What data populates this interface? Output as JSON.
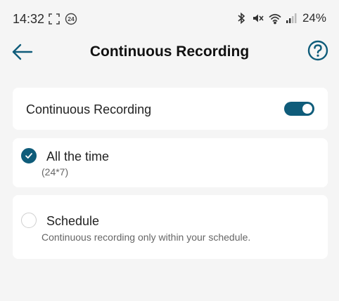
{
  "status_bar": {
    "time": "14:32",
    "battery": "24%",
    "icons": [
      "screenshot-icon",
      "24-badge-icon",
      "bluetooth-icon",
      "mute-icon",
      "wifi-icon",
      "signal-icon"
    ]
  },
  "header": {
    "title": "Continuous Recording",
    "back_icon": "back-arrow-icon",
    "help_icon": "help-circle-icon"
  },
  "settings": {
    "continuous_recording": {
      "label": "Continuous Recording",
      "enabled": true
    },
    "options": [
      {
        "title": "All the time",
        "subtitle": "(24*7)",
        "selected": true
      },
      {
        "title": "Schedule",
        "subtitle": "Continuous recording only within your schedule.",
        "selected": false
      }
    ]
  },
  "colors": {
    "accent": "#0f5c7a",
    "background": "#f5f5f5",
    "card": "#ffffff"
  }
}
